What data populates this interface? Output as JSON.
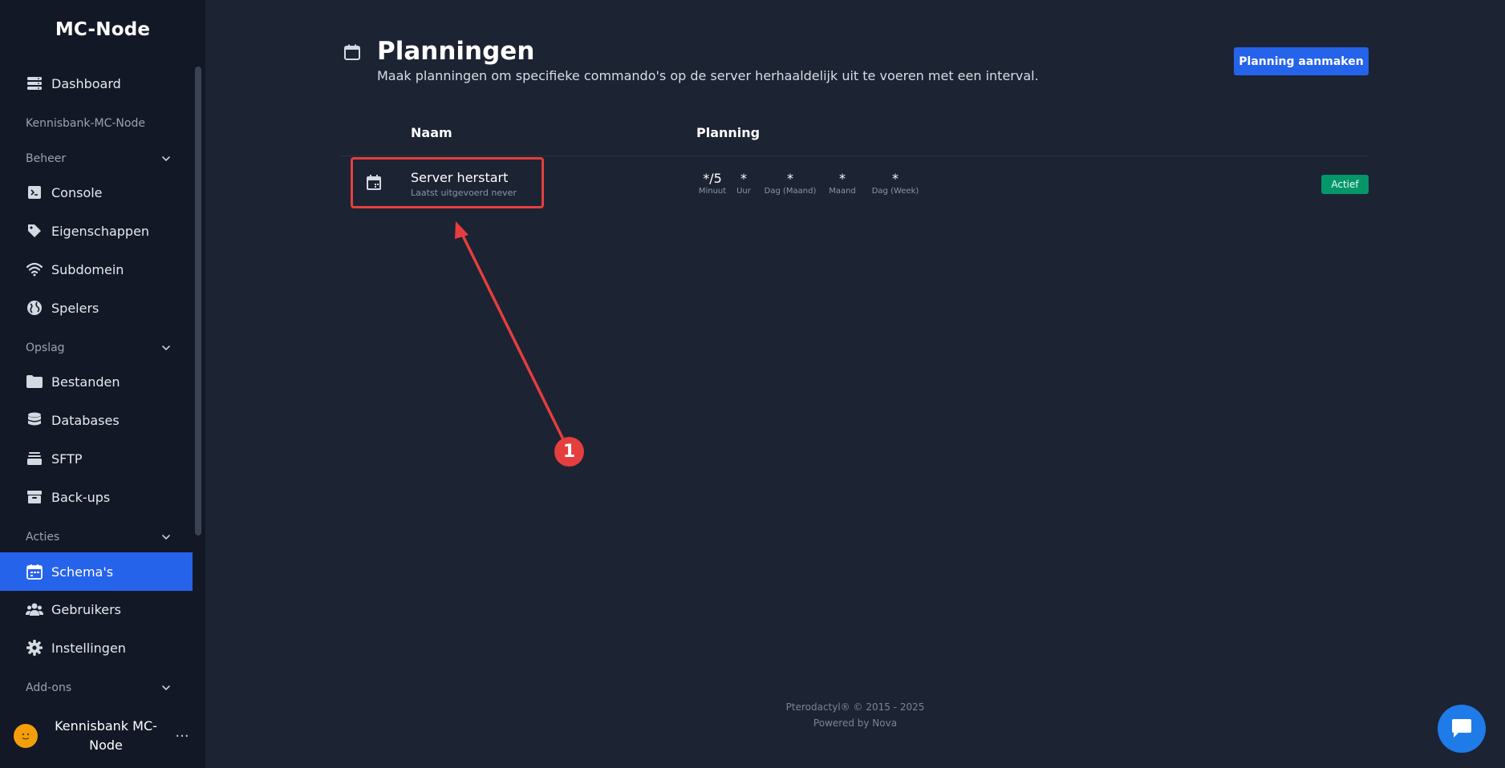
{
  "sidebar": {
    "brand": "MC-Node",
    "server_name": "Kennisbank-MC-Node",
    "dashboard": "Dashboard",
    "sections": {
      "beheer": "Beheer",
      "opslag": "Opslag",
      "acties": "Acties",
      "addons": "Add-ons"
    },
    "items": {
      "console": "Console",
      "eigenschappen": "Eigenschappen",
      "subdomein": "Subdomein",
      "spelers": "Spelers",
      "bestanden": "Bestanden",
      "databases": "Databases",
      "sftp": "SFTP",
      "backups": "Back-ups",
      "schemas": "Schema's",
      "gebruikers": "Gebruikers",
      "instellingen": "Instellingen"
    },
    "active_item": "Schema's",
    "user": {
      "name_line1": "Kennisbank MC-",
      "name_line2": "Node",
      "avatar_glyph": "̈‿"
    },
    "more_label": "..."
  },
  "main": {
    "title": "Planningen",
    "description": "Maak planningen om specifieke commando's op de server herhaaldelijk uit te voeren met een interval.",
    "create_button": "Planning aanmaken",
    "columns": {
      "name": "Naam",
      "schedule": "Planning"
    },
    "schedules": [
      {
        "name": "Server herstart",
        "last_run": "Laatst uitgevoerd never",
        "cron": {
          "minute": "*/5",
          "minute_label": "Minuut",
          "hour": "*",
          "hour_label": "Uur",
          "day_month": "*",
          "day_month_label": "Dag (Maand)",
          "month": "*",
          "month_label": "Maand",
          "day_week": "*",
          "day_week_label": "Dag (Week)"
        },
        "status": "Actief"
      }
    ]
  },
  "annotation": {
    "marker": "1"
  },
  "footer": {
    "line1": "Pterodactyl® © 2015 - 2025",
    "line2": "Powered by Nova"
  },
  "colors": {
    "background": "#1c2333",
    "sidebar": "#121826",
    "accent": "#2563eb",
    "status_active": "#059669",
    "annotation": "#e53e3e"
  }
}
